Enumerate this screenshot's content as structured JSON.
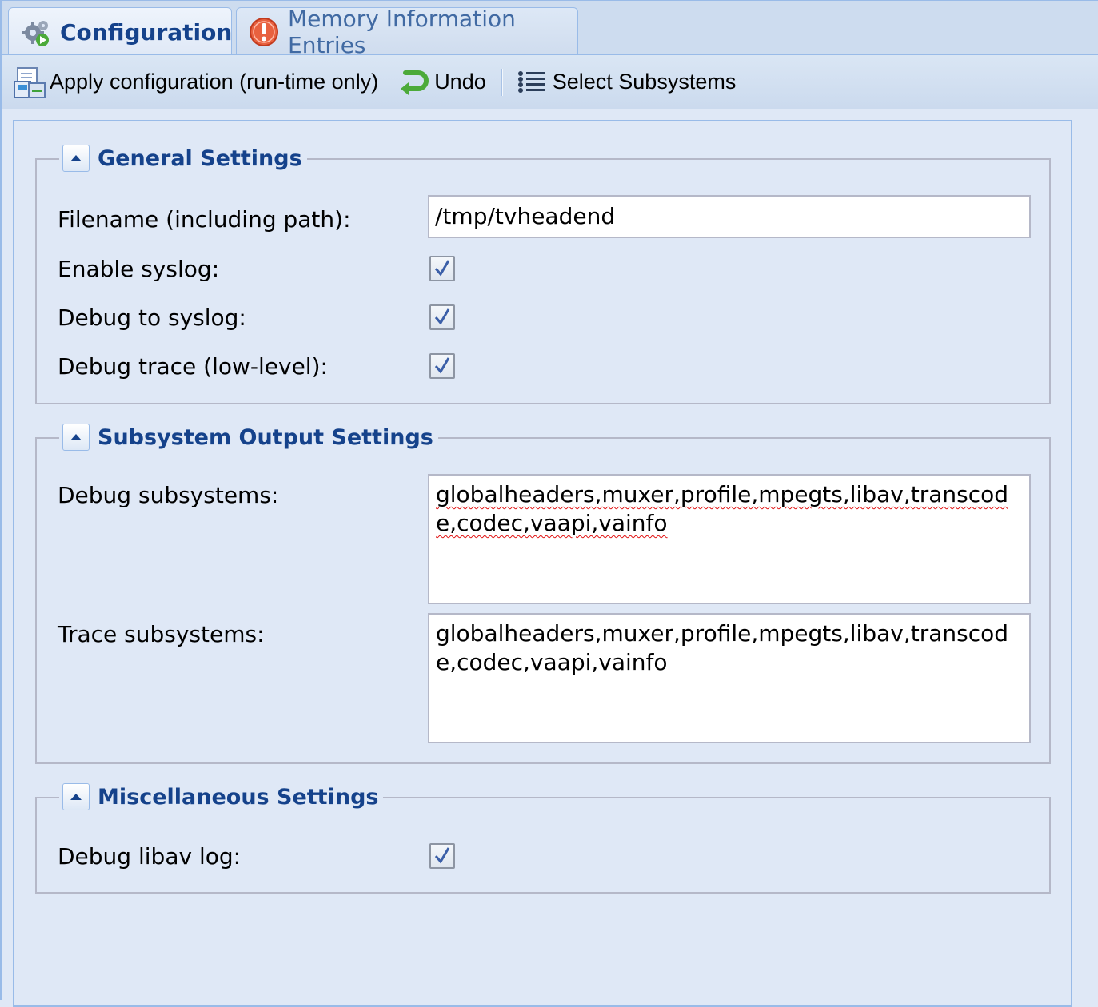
{
  "tabs": [
    {
      "label": "Configuration",
      "icon": "gears-icon",
      "active": true
    },
    {
      "label": "Memory Information Entries",
      "icon": "warning-circle-icon",
      "active": false
    }
  ],
  "toolbar": {
    "apply_label": "Apply configuration (run-time only)",
    "undo_label": "Undo",
    "select_subsystems_label": "Select Subsystems"
  },
  "general": {
    "title": "General Settings",
    "filename_label": "Filename (including path):",
    "filename_value": "/tmp/tvheadend",
    "syslog_label": "Enable syslog:",
    "syslog_checked": true,
    "debug_syslog_label": "Debug to syslog:",
    "debug_syslog_checked": true,
    "trace_label": "Debug trace (low-level):",
    "trace_checked": true
  },
  "subsystems": {
    "title": "Subsystem Output Settings",
    "debug_label": "Debug subsystems:",
    "debug_value": "globalheaders,muxer,profile,mpegts,libav,transcode,codec,vaapi,vainfo",
    "trace_label": "Trace subsystems:",
    "trace_value": "globalheaders,muxer,profile,mpegts,libav,transcode,codec,vaapi,vainfo"
  },
  "misc": {
    "title": "Miscellaneous Settings",
    "libav_label": "Debug libav log:",
    "libav_checked": true
  },
  "colors": {
    "background": "#dfe8f6",
    "border": "#99bbe8",
    "title": "#15428b"
  }
}
